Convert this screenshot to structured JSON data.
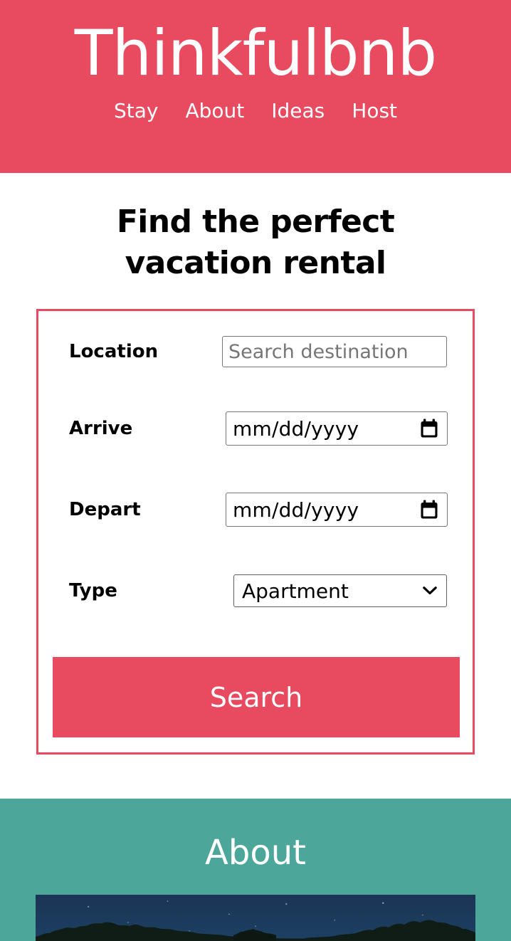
{
  "header": {
    "brand": "Thinkfulbnb",
    "brand_color": "#e84a5f",
    "nav": [
      {
        "label": "Stay"
      },
      {
        "label": "About"
      },
      {
        "label": "Ideas"
      },
      {
        "label": "Host"
      }
    ]
  },
  "hero": {
    "title": "Find the perfect vacation rental"
  },
  "search_form": {
    "border_color": "#e84a5f",
    "fields": [
      {
        "label": "Location",
        "type": "text",
        "value": "",
        "placeholder": "Search destination"
      },
      {
        "label": "Arrive",
        "type": "date",
        "value": "",
        "placeholder": "mm/dd/yyyy",
        "icon": "calendar-icon"
      },
      {
        "label": "Depart",
        "type": "date",
        "value": "",
        "placeholder": "mm/dd/yyyy",
        "icon": "calendar-icon"
      },
      {
        "label": "Type",
        "type": "select",
        "value": "Apartment",
        "icon": "chevron-down-icon"
      }
    ],
    "submit_label": "Search",
    "submit_color": "#e84a5f"
  },
  "about": {
    "title": "About",
    "background_color": "#4ca699",
    "photo_alt": "night sky with stars above tree silhouettes"
  }
}
